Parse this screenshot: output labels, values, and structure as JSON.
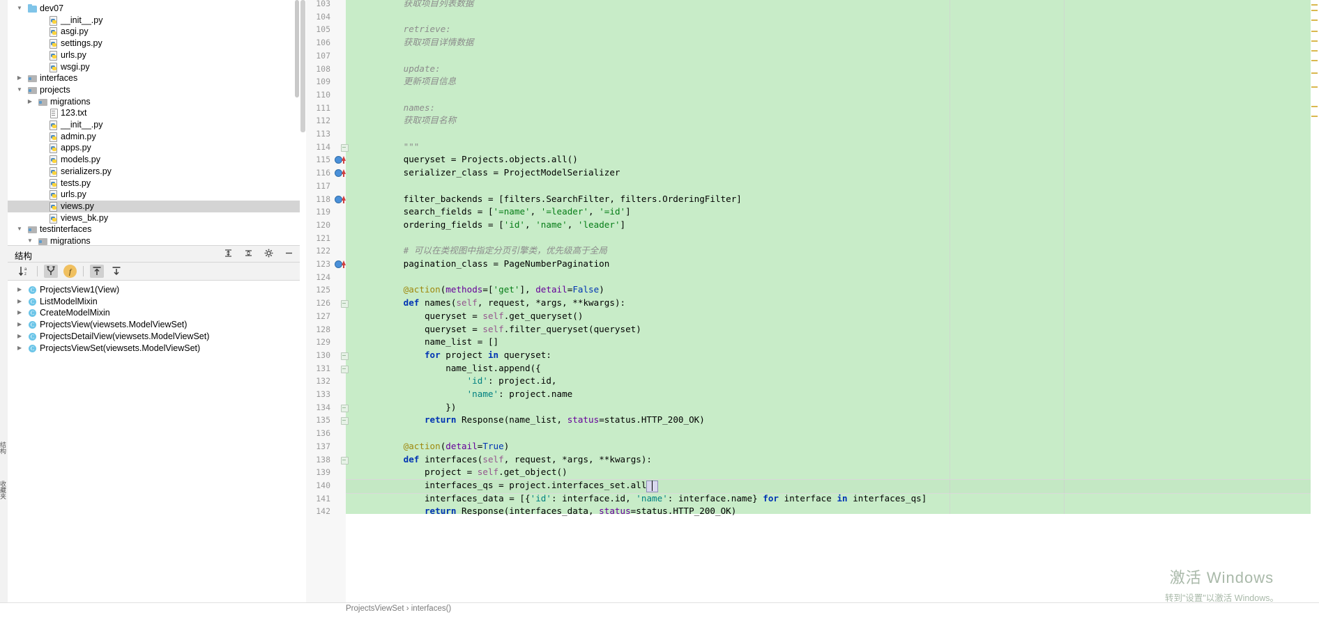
{
  "window": {
    "left_dock_tabs": [
      "结构",
      "收藏夹"
    ]
  },
  "project_tree": {
    "items": [
      {
        "label": "dev07",
        "icon": "folder-open-blue-icon",
        "indent": 1,
        "arrow": "down",
        "selected": false
      },
      {
        "label": "__init__.py",
        "icon": "python-file-icon",
        "indent": 3,
        "arrow": "",
        "selected": false
      },
      {
        "label": "asgi.py",
        "icon": "python-file-icon",
        "indent": 3,
        "arrow": "",
        "selected": false
      },
      {
        "label": "settings.py",
        "icon": "python-file-icon",
        "indent": 3,
        "arrow": "",
        "selected": false
      },
      {
        "label": "urls.py",
        "icon": "python-file-icon",
        "indent": 3,
        "arrow": "",
        "selected": false
      },
      {
        "label": "wsgi.py",
        "icon": "python-file-icon",
        "indent": 3,
        "arrow": "",
        "selected": false
      },
      {
        "label": "interfaces",
        "icon": "folder-module-icon",
        "indent": 1,
        "arrow": "right",
        "selected": false
      },
      {
        "label": "projects",
        "icon": "folder-module-icon",
        "indent": 1,
        "arrow": "down",
        "selected": false
      },
      {
        "label": "migrations",
        "icon": "folder-module-icon",
        "indent": 2,
        "arrow": "right",
        "selected": false
      },
      {
        "label": "123.txt",
        "icon": "text-file-icon",
        "indent": 3,
        "arrow": "",
        "selected": false
      },
      {
        "label": "__init__.py",
        "icon": "python-file-icon",
        "indent": 3,
        "arrow": "",
        "selected": false
      },
      {
        "label": "admin.py",
        "icon": "python-file-icon",
        "indent": 3,
        "arrow": "",
        "selected": false
      },
      {
        "label": "apps.py",
        "icon": "python-file-icon",
        "indent": 3,
        "arrow": "",
        "selected": false
      },
      {
        "label": "models.py",
        "icon": "python-file-icon",
        "indent": 3,
        "arrow": "",
        "selected": false
      },
      {
        "label": "serializers.py",
        "icon": "python-file-icon",
        "indent": 3,
        "arrow": "",
        "selected": false
      },
      {
        "label": "tests.py",
        "icon": "python-file-icon",
        "indent": 3,
        "arrow": "",
        "selected": false
      },
      {
        "label": "urls.py",
        "icon": "python-file-icon",
        "indent": 3,
        "arrow": "",
        "selected": false
      },
      {
        "label": "views.py",
        "icon": "python-file-icon",
        "indent": 3,
        "arrow": "",
        "selected": true
      },
      {
        "label": "views_bk.py",
        "icon": "python-file-icon",
        "indent": 3,
        "arrow": "",
        "selected": false
      },
      {
        "label": "testinterfaces",
        "icon": "folder-module-icon",
        "indent": 1,
        "arrow": "down",
        "selected": false
      },
      {
        "label": "migrations",
        "icon": "folder-module-icon",
        "indent": 2,
        "arrow": "down",
        "selected": false
      }
    ]
  },
  "structure_panel": {
    "title": "结构",
    "header_icons": [
      "expand-collapse-icon",
      "collapse-all-icon",
      "settings-gear-icon",
      "minimize-icon"
    ],
    "toolbar_buttons": [
      {
        "name": "sort-alphabetically-icon",
        "active": false
      },
      {
        "name": "show-inherited-icon",
        "active": true
      },
      {
        "name": "show-fields-icon",
        "active": true
      },
      {
        "name": "scroll-from-source-icon",
        "active": true
      },
      {
        "name": "scroll-to-source-icon",
        "active": false
      }
    ],
    "items": [
      {
        "label": "ProjectsView1(View)",
        "badge": "C"
      },
      {
        "label": "ListModelMixin",
        "badge": "C"
      },
      {
        "label": "CreateModelMixin",
        "badge": "C"
      },
      {
        "label": "ProjectsView(viewsets.ModelViewSet)",
        "badge": "C"
      },
      {
        "label": "ProjectsDetailView(viewsets.ModelViewSet)",
        "badge": "C"
      },
      {
        "label": "ProjectsViewSet(viewsets.ModelViewSet)",
        "badge": "C"
      }
    ]
  },
  "editor": {
    "first_line_number": 103,
    "lines": [
      {
        "n": 103,
        "indent": 8,
        "segs": [
          {
            "t": "获取项目列表数据",
            "c": "doc"
          }
        ]
      },
      {
        "n": 104,
        "indent": 0,
        "segs": []
      },
      {
        "n": 105,
        "indent": 8,
        "segs": [
          {
            "t": "retrieve:",
            "c": "doc"
          }
        ]
      },
      {
        "n": 106,
        "indent": 8,
        "segs": [
          {
            "t": "获取项目详情数据",
            "c": "doc"
          }
        ]
      },
      {
        "n": 107,
        "indent": 0,
        "segs": []
      },
      {
        "n": 108,
        "indent": 8,
        "segs": [
          {
            "t": "update:",
            "c": "doc"
          }
        ]
      },
      {
        "n": 109,
        "indent": 8,
        "segs": [
          {
            "t": "更新项目信息",
            "c": "doc"
          }
        ]
      },
      {
        "n": 110,
        "indent": 0,
        "segs": []
      },
      {
        "n": 111,
        "indent": 8,
        "segs": [
          {
            "t": "names:",
            "c": "doc"
          }
        ]
      },
      {
        "n": 112,
        "indent": 8,
        "segs": [
          {
            "t": "获取项目名称",
            "c": "doc"
          }
        ]
      },
      {
        "n": 113,
        "indent": 0,
        "segs": []
      },
      {
        "n": 114,
        "indent": 8,
        "fold": true,
        "segs": [
          {
            "t": "\"\"\"",
            "c": "doc"
          }
        ]
      },
      {
        "n": 115,
        "indent": 8,
        "bp": true,
        "segs": [
          {
            "t": "queryset = Projects.objects.all()",
            "c": ""
          }
        ]
      },
      {
        "n": 116,
        "indent": 8,
        "bp": true,
        "segs": [
          {
            "t": "serializer_class = ProjectModelSerializer",
            "c": ""
          }
        ]
      },
      {
        "n": 117,
        "indent": 0,
        "segs": []
      },
      {
        "n": 118,
        "indent": 8,
        "bp": true,
        "segs": [
          {
            "t": "filter_backends = [filters.SearchFilter, filters.OrderingFilter]",
            "c": ""
          }
        ]
      },
      {
        "n": 119,
        "indent": 8,
        "segs": [
          {
            "t": "search_fields = [",
            "c": ""
          },
          {
            "t": "'=name'",
            "c": "s"
          },
          {
            "t": ", ",
            "c": ""
          },
          {
            "t": "'=leader'",
            "c": "s"
          },
          {
            "t": ", ",
            "c": ""
          },
          {
            "t": "'=id'",
            "c": "s"
          },
          {
            "t": "]",
            "c": ""
          }
        ]
      },
      {
        "n": 120,
        "indent": 8,
        "segs": [
          {
            "t": "ordering_fields = [",
            "c": ""
          },
          {
            "t": "'id'",
            "c": "s"
          },
          {
            "t": ", ",
            "c": ""
          },
          {
            "t": "'name'",
            "c": "s"
          },
          {
            "t": ", ",
            "c": ""
          },
          {
            "t": "'leader'",
            "c": "s"
          },
          {
            "t": "]",
            "c": ""
          }
        ]
      },
      {
        "n": 121,
        "indent": 0,
        "segs": []
      },
      {
        "n": 122,
        "indent": 8,
        "segs": [
          {
            "t": "# 可以在类视图中指定分页引擎类，优先级高于全局",
            "c": "cmt"
          }
        ]
      },
      {
        "n": 123,
        "indent": 8,
        "bp": true,
        "segs": [
          {
            "t": "pagination_class = PageNumberPagination",
            "c": ""
          }
        ]
      },
      {
        "n": 124,
        "indent": 0,
        "segs": []
      },
      {
        "n": 125,
        "indent": 8,
        "segs": [
          {
            "t": "@action",
            "c": "dec"
          },
          {
            "t": "(",
            "c": ""
          },
          {
            "t": "methods",
            "c": "param"
          },
          {
            "t": "=[",
            "c": ""
          },
          {
            "t": "'get'",
            "c": "s"
          },
          {
            "t": "], ",
            "c": ""
          },
          {
            "t": "detail",
            "c": "param"
          },
          {
            "t": "=",
            "c": ""
          },
          {
            "t": "False",
            "c": "kw"
          },
          {
            "t": ")",
            "c": ""
          }
        ]
      },
      {
        "n": 126,
        "indent": 8,
        "fold": true,
        "segs": [
          {
            "t": "def ",
            "c": "k"
          },
          {
            "t": "names(",
            "c": ""
          },
          {
            "t": "self",
            "c": "self"
          },
          {
            "t": ", request, *args, **kwargs):",
            "c": ""
          }
        ]
      },
      {
        "n": 127,
        "indent": 12,
        "segs": [
          {
            "t": "queryset = ",
            "c": ""
          },
          {
            "t": "self",
            "c": "self"
          },
          {
            "t": ".get_queryset()",
            "c": ""
          }
        ]
      },
      {
        "n": 128,
        "indent": 12,
        "segs": [
          {
            "t": "queryset = ",
            "c": ""
          },
          {
            "t": "self",
            "c": "self"
          },
          {
            "t": ".filter_queryset(queryset)",
            "c": ""
          }
        ]
      },
      {
        "n": 129,
        "indent": 12,
        "segs": [
          {
            "t": "name_list = []",
            "c": ""
          }
        ]
      },
      {
        "n": 130,
        "indent": 12,
        "fold": true,
        "segs": [
          {
            "t": "for ",
            "c": "k"
          },
          {
            "t": "project ",
            "c": ""
          },
          {
            "t": "in ",
            "c": "k"
          },
          {
            "t": "queryset:",
            "c": ""
          }
        ]
      },
      {
        "n": 131,
        "indent": 16,
        "fold": true,
        "segs": [
          {
            "t": "name_list.append({",
            "c": ""
          }
        ]
      },
      {
        "n": 132,
        "indent": 20,
        "segs": [
          {
            "t": "'id'",
            "c": "s2"
          },
          {
            "t": ": project.id,",
            "c": ""
          }
        ]
      },
      {
        "n": 133,
        "indent": 20,
        "segs": [
          {
            "t": "'name'",
            "c": "s2"
          },
          {
            "t": ": project.name",
            "c": ""
          }
        ]
      },
      {
        "n": 134,
        "indent": 16,
        "fold": true,
        "segs": [
          {
            "t": "})",
            "c": ""
          }
        ]
      },
      {
        "n": 135,
        "indent": 12,
        "fold": true,
        "segs": [
          {
            "t": "return ",
            "c": "k"
          },
          {
            "t": "Response(name_list, ",
            "c": ""
          },
          {
            "t": "status",
            "c": "param"
          },
          {
            "t": "=status.HTTP_200_OK)",
            "c": ""
          }
        ]
      },
      {
        "n": 136,
        "indent": 0,
        "segs": []
      },
      {
        "n": 137,
        "indent": 8,
        "segs": [
          {
            "t": "@action",
            "c": "dec"
          },
          {
            "t": "(",
            "c": ""
          },
          {
            "t": "detail",
            "c": "param"
          },
          {
            "t": "=",
            "c": ""
          },
          {
            "t": "True",
            "c": "kw"
          },
          {
            "t": ")",
            "c": ""
          }
        ]
      },
      {
        "n": 138,
        "indent": 8,
        "fold": true,
        "segs": [
          {
            "t": "def ",
            "c": "k"
          },
          {
            "t": "interfaces(",
            "c": ""
          },
          {
            "t": "self",
            "c": "self"
          },
          {
            "t": ", request, *args, **kwargs):",
            "c": ""
          }
        ]
      },
      {
        "n": 139,
        "indent": 12,
        "segs": [
          {
            "t": "project = ",
            "c": ""
          },
          {
            "t": "self",
            "c": "self"
          },
          {
            "t": ".get_object()",
            "c": ""
          }
        ]
      },
      {
        "n": 140,
        "indent": 12,
        "caret": true,
        "segs": [
          {
            "t": "interfaces_qs = project.interfaces_set.all()",
            "c": ""
          }
        ]
      },
      {
        "n": 141,
        "indent": 12,
        "segs": [
          {
            "t": "interfaces_data = [{",
            "c": ""
          },
          {
            "t": "'id'",
            "c": "s2"
          },
          {
            "t": ": interface.id, ",
            "c": ""
          },
          {
            "t": "'name'",
            "c": "s2"
          },
          {
            "t": ": interface.name} ",
            "c": ""
          },
          {
            "t": "for ",
            "c": "k"
          },
          {
            "t": "interface ",
            "c": ""
          },
          {
            "t": "in ",
            "c": "k"
          },
          {
            "t": "interfaces_qs]",
            "c": ""
          }
        ]
      },
      {
        "n": 142,
        "indent": 12,
        "segs": [
          {
            "t": "return ",
            "c": "k"
          },
          {
            "t": "Response(interfaces_data, ",
            "c": ""
          },
          {
            "t": "status",
            "c": "param"
          },
          {
            "t": "=status.HTTP_200_OK)",
            "c": ""
          }
        ]
      }
    ],
    "caret_text": "()",
    "breadcrumb": "ProjectsViewSet  ›  interfaces()"
  },
  "watermark": {
    "line1": "激活 Windows",
    "line2": "转到\"设置\"以激活 Windows。"
  },
  "colors": {
    "highlight_green": "#c8ecc8",
    "selection_gray": "#d4d4d4",
    "gutter_bg": "#f7f7f7",
    "keyword_blue": "#0033b3",
    "string_green": "#067d17",
    "comment_gray": "#8c8c8c",
    "decorator_gold": "#9e880d",
    "self_purple": "#94558d",
    "class_badge_blue": "#6cc5e8"
  }
}
